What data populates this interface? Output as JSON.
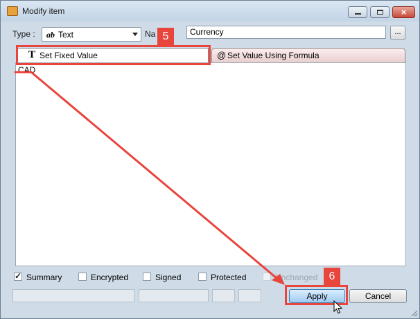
{
  "window": {
    "title": "Modify item"
  },
  "form": {
    "type_label": "Type :",
    "type_value": "Text",
    "type_icon_text": "ab",
    "name_label_visible": "Na",
    "name_value": "Currency",
    "ellipsis_label": "..."
  },
  "tabs": [
    {
      "icon_text": "T",
      "label": "Set Fixed Value"
    },
    {
      "icon_text": "@",
      "label": "Set Value Using Formula"
    }
  ],
  "content": {
    "value": "CAD"
  },
  "options": [
    {
      "label": "Summary",
      "checked": true
    },
    {
      "label": "Encrypted",
      "checked": false
    },
    {
      "label": "Signed",
      "checked": false
    },
    {
      "label": "Protected",
      "checked": false
    },
    {
      "label": "Unchanged",
      "checked": false,
      "disabled": true
    }
  ],
  "buttons": {
    "apply": "Apply",
    "cancel": "Cancel"
  },
  "callouts": {
    "step5": "5",
    "step6": "6"
  },
  "colors": {
    "callout": "#e8453d",
    "apply_button": "#9fcaf1",
    "window_bg": "#cfdbe7"
  },
  "icons": {
    "app": "app-icon",
    "close": "close-icon",
    "minimize": "minimize-icon",
    "maximize": "maximize-icon"
  }
}
